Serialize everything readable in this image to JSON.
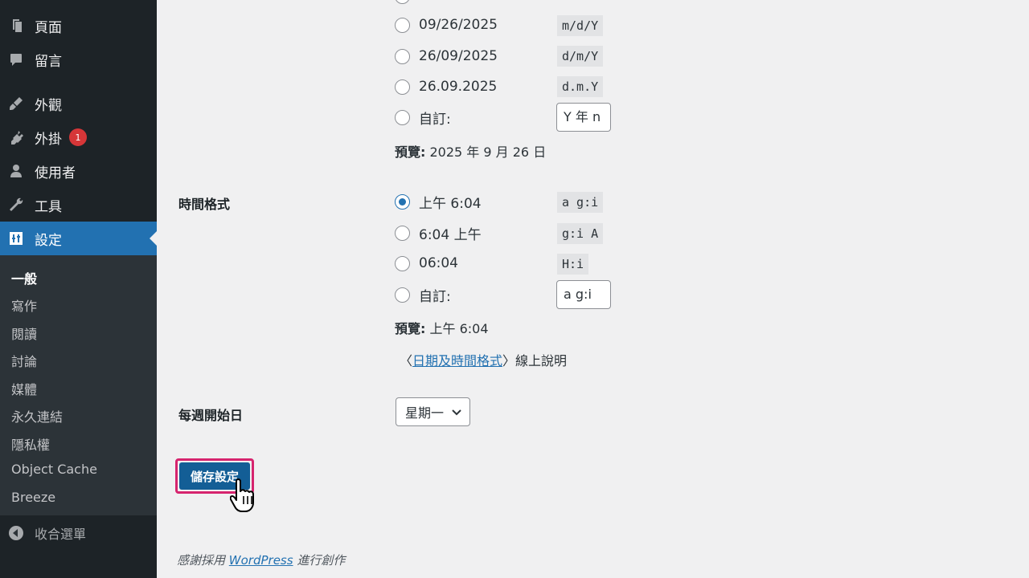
{
  "sidebar": {
    "items": [
      {
        "label": "頁面",
        "icon": "pages-icon"
      },
      {
        "label": "留言",
        "icon": "comments-icon"
      },
      {
        "label": "外觀",
        "icon": "appearance-icon"
      },
      {
        "label": "外掛",
        "icon": "plugins-icon",
        "badge": "1"
      },
      {
        "label": "使用者",
        "icon": "users-icon"
      },
      {
        "label": "工具",
        "icon": "tools-icon"
      },
      {
        "label": "設定",
        "icon": "settings-icon",
        "active": true
      }
    ],
    "submenu": [
      "一般",
      "寫作",
      "閱讀",
      "討論",
      "媒體",
      "永久連結",
      "隱私權",
      "Object Cache",
      "Breeze"
    ],
    "collapse_label": "收合選單"
  },
  "date_format": {
    "options": [
      {
        "label": "09/26/2025",
        "code": "m/d/Y"
      },
      {
        "label": "26/09/2025",
        "code": "d/m/Y"
      },
      {
        "label": "26.09.2025",
        "code": "d.m.Y"
      }
    ],
    "custom_label": "自訂:",
    "custom_value": "Y 年 n",
    "preview_label": "預覽:",
    "preview_value": "2025 年 9 月 26 日"
  },
  "time_format": {
    "label": "時間格式",
    "options": [
      {
        "label": "上午 6:04",
        "code": "a g:i",
        "checked": true
      },
      {
        "label": "6:04 上午",
        "code": "g:i A"
      },
      {
        "label": "06:04",
        "code": "H:i"
      }
    ],
    "custom_label": "自訂:",
    "custom_value": "a g:i",
    "preview_label": "預覽:",
    "preview_value": "上午 6:04"
  },
  "help": {
    "prefix": "〈",
    "link": "日期及時間格式",
    "suffix": "〉線上說明"
  },
  "week_start": {
    "label": "每週開始日",
    "value": "星期一"
  },
  "save_label": "儲存設定",
  "footer": {
    "prefix": "感謝採用 ",
    "link": "WordPress",
    "suffix": " 進行創作"
  },
  "colors": {
    "sidebar_bg": "#1d2327",
    "active": "#2271b1",
    "highlight": "#d6246e",
    "badge": "#d63638"
  }
}
